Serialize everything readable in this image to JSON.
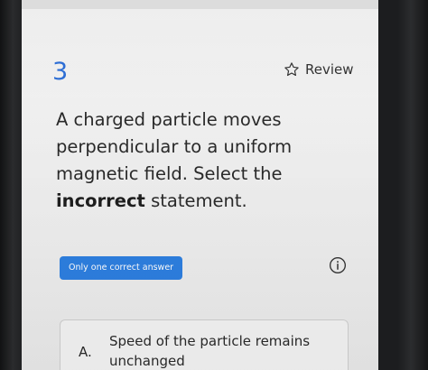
{
  "question": {
    "number": "3",
    "review_label": "Review",
    "text_before": "A charged particle moves perpendicular to a uniform magnetic field. Select the ",
    "text_bold": "incorrect",
    "text_after": " statement."
  },
  "answer_type": {
    "badge_label": "Only one correct answer"
  },
  "options": [
    {
      "letter": "A.",
      "text": "Speed of the particle remains unchanged"
    }
  ],
  "colors": {
    "accent": "#2d7fe0",
    "number": "#2e6fd6"
  },
  "icons": {
    "review": "star-outline-icon",
    "info": "info-icon"
  }
}
